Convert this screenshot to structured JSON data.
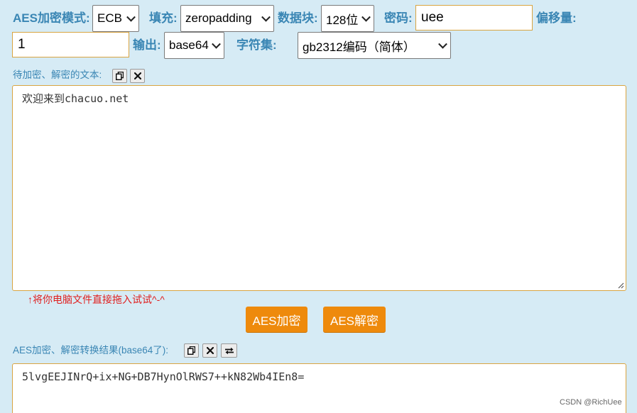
{
  "row1": {
    "mode_label": "AES加密模式:",
    "mode_value": "ECB",
    "padding_label": "填充:",
    "padding_value": "zeropadding",
    "block_label": "数据块:",
    "block_value": "128位",
    "password_label": "密码:",
    "password_value": "uee",
    "offset_label": "偏移量:"
  },
  "row2": {
    "offset_value": "1",
    "output_label": "输出:",
    "output_value": "base64",
    "charset_label": "字符集:",
    "charset_value": "gb2312编码（简体）"
  },
  "input_section": {
    "label": "待加密、解密的文本:",
    "text": "欢迎来到chacuo.net",
    "drag_hint": "↑将你电脑文件直接拖入试试^-^"
  },
  "actions": {
    "encrypt": "AES加密",
    "decrypt": "AES解密"
  },
  "output_section": {
    "label": "AES加密、解密转换结果(base64了):",
    "text": "5lvgEEJINrQ+ix+NG+DB7HynOlRWS7++kN82Wb4IEn8="
  },
  "watermark": "CSDN @RichUee",
  "colors": {
    "background": "#d6ebf5",
    "label": "#3a86b4",
    "accent_button": "#ee8a0c",
    "field_border": "#d9a441",
    "hint": "#e02020"
  }
}
